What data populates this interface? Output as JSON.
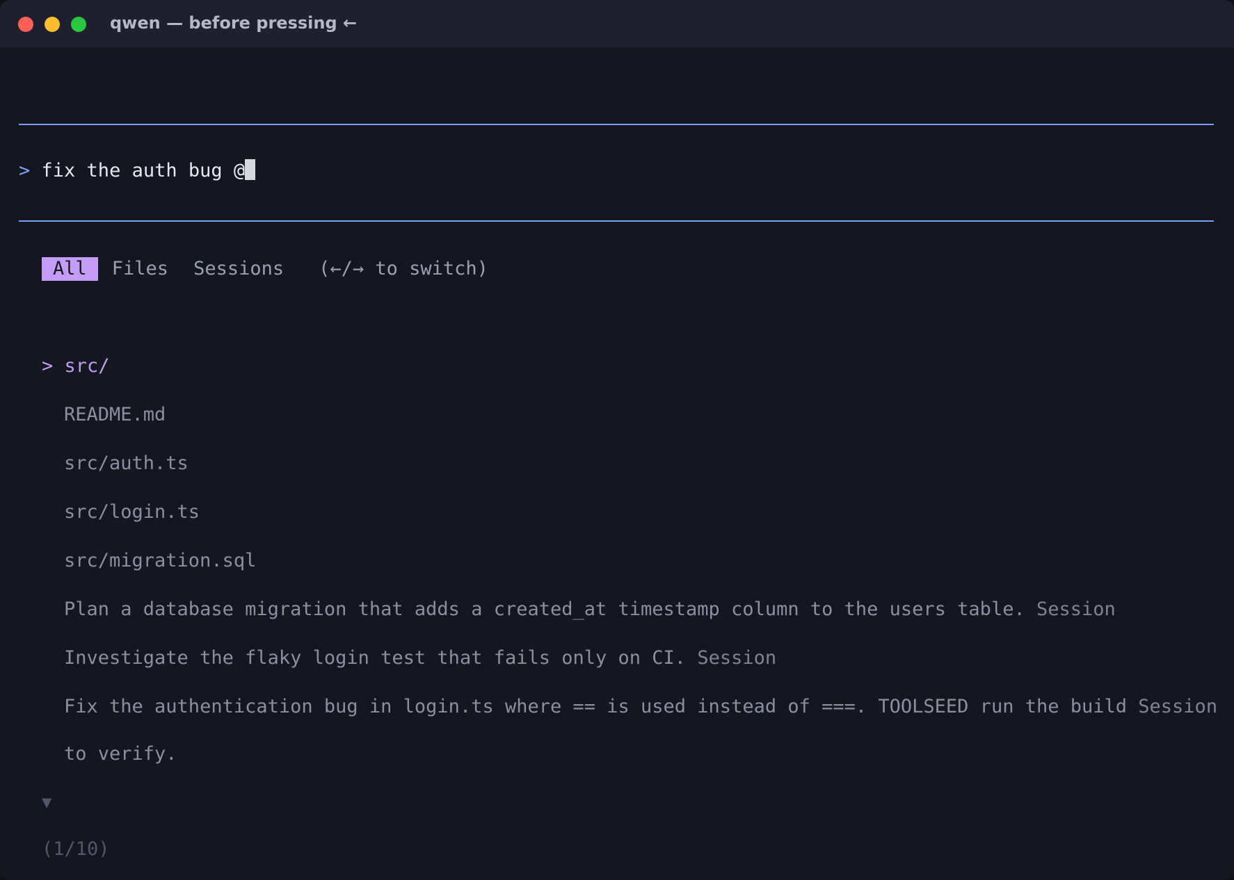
{
  "window": {
    "title": "qwen — before pressing ←"
  },
  "prompt": {
    "symbol": ">",
    "text": "fix the auth bug @"
  },
  "tabs": {
    "items": [
      {
        "label": "All"
      },
      {
        "label": "Files"
      },
      {
        "label": "Sessions"
      }
    ],
    "hint": "(←/→ to switch)"
  },
  "results": {
    "selected_marker": ">",
    "items": [
      {
        "label": "src/"
      },
      {
        "label": "README.md"
      },
      {
        "label": "src/auth.ts"
      },
      {
        "label": "src/login.ts"
      },
      {
        "label": "src/migration.sql"
      },
      {
        "label": "Plan a database migration that adds a created_at timestamp column to the users table.",
        "tag": "Session"
      },
      {
        "label": "Investigate the flaky login test that fails only on CI.",
        "tag": "Session"
      },
      {
        "label": "Fix the authentication bug in login.ts where == is used instead of ===. TOOLSEED run the build",
        "tag": "Session",
        "continuation": "to verify."
      }
    ],
    "scroll_indicator": "▼",
    "counter": "(1/10)"
  }
}
